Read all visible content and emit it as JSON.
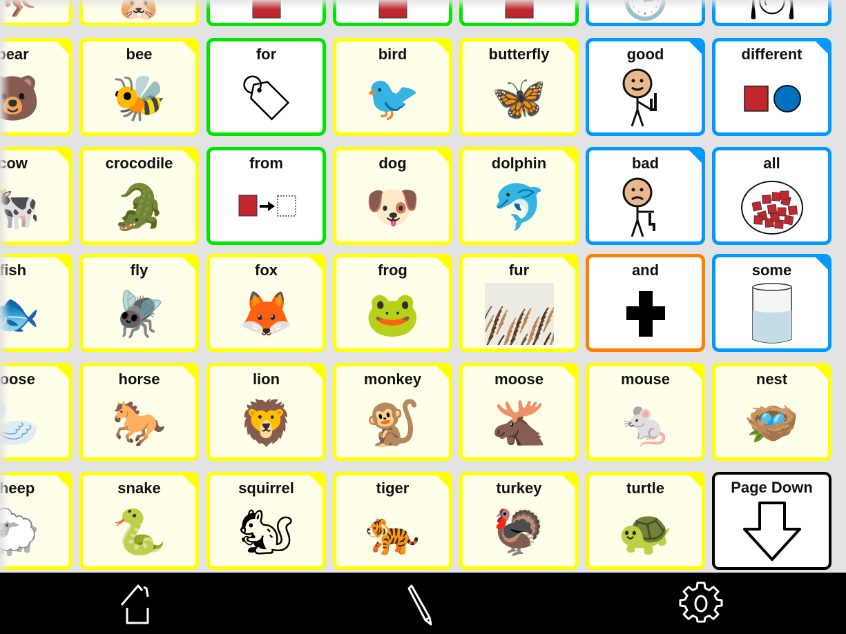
{
  "colors": {
    "noun": "#ffff00",
    "preposition": "#00e600",
    "descriptor": "#0099ff",
    "conjunction": "#ff8000",
    "navigation": "#000000",
    "grid_background": "#e3e3e3",
    "toolbar_background": "#000000"
  },
  "top_partial_row": [
    {
      "label": "",
      "category": "noun",
      "icon": "kangaroo-icon"
    },
    {
      "label": "",
      "category": "noun",
      "icon": "guinea-pig-icon"
    },
    {
      "label": "",
      "category": "preposition",
      "icon": "preposition-symbol-icon"
    },
    {
      "label": "",
      "category": "preposition",
      "icon": "preposition-symbol-icon"
    },
    {
      "label": "",
      "category": "preposition",
      "icon": "preposition-symbol-icon"
    },
    {
      "label": "",
      "category": "descriptor",
      "icon": "clock-icon"
    },
    {
      "label": "",
      "category": "descriptor",
      "icon": "plate-icon"
    }
  ],
  "rows": [
    [
      {
        "label": "bear",
        "category": "noun",
        "icon": "bear-icon",
        "glyph": "🐻",
        "folder": true
      },
      {
        "label": "bee",
        "category": "noun",
        "icon": "bee-icon",
        "glyph": "🐝",
        "folder": true
      },
      {
        "label": "for",
        "category": "preposition",
        "icon": "tag-icon",
        "glyph": "🏷",
        "folder": false
      },
      {
        "label": "bird",
        "category": "noun",
        "icon": "bird-icon",
        "glyph": "🐦",
        "folder": true
      },
      {
        "label": "butterfly",
        "category": "noun",
        "icon": "butterfly-icon",
        "glyph": "🦋",
        "folder": true
      },
      {
        "label": "good",
        "category": "descriptor",
        "icon": "thumbs-up-person-icon",
        "glyph": "👍",
        "folder": true
      },
      {
        "label": "different",
        "category": "descriptor",
        "icon": "square-and-circle-icon",
        "glyph": "",
        "folder": true
      }
    ],
    [
      {
        "label": "cow",
        "category": "noun",
        "icon": "cow-icon",
        "glyph": "🐄",
        "folder": true
      },
      {
        "label": "crocodile",
        "category": "noun",
        "icon": "crocodile-icon",
        "glyph": "🐊",
        "folder": true
      },
      {
        "label": "from",
        "category": "preposition",
        "icon": "from-arrow-icon",
        "glyph": "",
        "folder": false
      },
      {
        "label": "dog",
        "category": "noun",
        "icon": "dog-icon",
        "glyph": "🐶",
        "folder": true
      },
      {
        "label": "dolphin",
        "category": "noun",
        "icon": "dolphin-icon",
        "glyph": "🐬",
        "folder": true
      },
      {
        "label": "bad",
        "category": "descriptor",
        "icon": "thumbs-down-person-icon",
        "glyph": "👎",
        "folder": true
      },
      {
        "label": "all",
        "category": "descriptor",
        "icon": "all-squares-icon",
        "glyph": "",
        "folder": false
      }
    ],
    [
      {
        "label": "fish",
        "category": "noun",
        "icon": "fish-icon",
        "glyph": "🐟",
        "folder": true
      },
      {
        "label": "fly",
        "category": "noun",
        "icon": "fly-icon",
        "glyph": "🪰",
        "folder": true
      },
      {
        "label": "fox",
        "category": "noun",
        "icon": "fox-icon",
        "glyph": "🦊",
        "folder": true
      },
      {
        "label": "frog",
        "category": "noun",
        "icon": "frog-icon",
        "glyph": "🐸",
        "folder": true
      },
      {
        "label": "fur",
        "category": "noun",
        "icon": "fur-icon",
        "glyph": "",
        "folder": true
      },
      {
        "label": "and",
        "category": "conjunction",
        "icon": "plus-icon",
        "glyph": "",
        "folder": false
      },
      {
        "label": "some",
        "category": "descriptor",
        "icon": "glass-of-water-icon",
        "glyph": "",
        "folder": true
      }
    ],
    [
      {
        "label": "goose",
        "category": "noun",
        "icon": "goose-icon",
        "glyph": "🦢",
        "folder": true
      },
      {
        "label": "horse",
        "category": "noun",
        "icon": "horse-icon",
        "glyph": "🐎",
        "folder": true
      },
      {
        "label": "lion",
        "category": "noun",
        "icon": "lion-icon",
        "glyph": "🦁",
        "folder": true
      },
      {
        "label": "monkey",
        "category": "noun",
        "icon": "monkey-icon",
        "glyph": "🐒",
        "folder": true
      },
      {
        "label": "moose",
        "category": "noun",
        "icon": "moose-icon",
        "glyph": "🫎",
        "folder": true
      },
      {
        "label": "mouse",
        "category": "noun",
        "icon": "mouse-icon",
        "glyph": "🐁",
        "folder": true
      },
      {
        "label": "nest",
        "category": "noun",
        "icon": "nest-icon",
        "glyph": "🪺",
        "folder": true
      }
    ],
    [
      {
        "label": "sheep",
        "category": "noun",
        "icon": "sheep-icon",
        "glyph": "🐑",
        "folder": true
      },
      {
        "label": "snake",
        "category": "noun",
        "icon": "snake-icon",
        "glyph": "🐍",
        "folder": true
      },
      {
        "label": "squirrel",
        "category": "noun",
        "icon": "squirrel-icon",
        "glyph": "🐿",
        "folder": true
      },
      {
        "label": "tiger",
        "category": "noun",
        "icon": "tiger-icon",
        "glyph": "🐅",
        "folder": true
      },
      {
        "label": "turkey",
        "category": "noun",
        "icon": "turkey-icon",
        "glyph": "🦃",
        "folder": true
      },
      {
        "label": "turtle",
        "category": "noun",
        "icon": "turtle-icon",
        "glyph": "🐢",
        "folder": true
      },
      {
        "label": "Page Down",
        "category": "navigation",
        "icon": "page-down-arrow-icon",
        "glyph": "",
        "folder": false
      }
    ]
  ],
  "toolbar": {
    "buttons": [
      {
        "name": "home-button",
        "icon": "home-icon"
      },
      {
        "name": "edit-button",
        "icon": "pencil-icon"
      },
      {
        "name": "settings-button",
        "icon": "gear-icon"
      }
    ]
  }
}
